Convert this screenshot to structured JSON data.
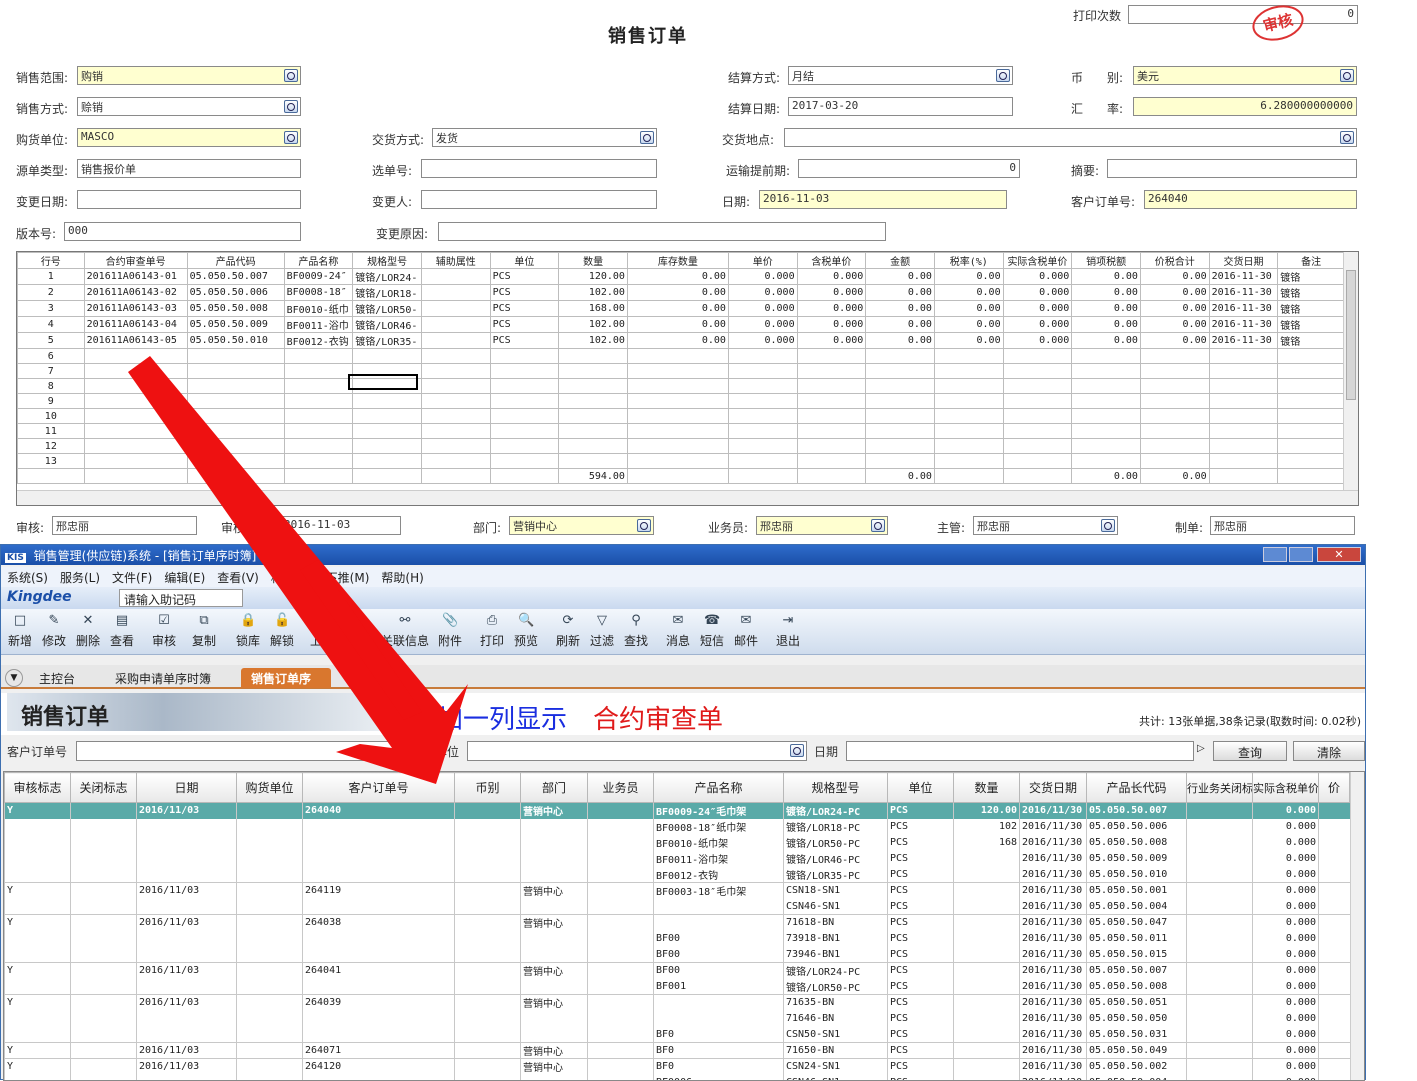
{
  "form": {
    "title": "销售订单",
    "print_count_label": "打印次数",
    "print_count": "0",
    "stamp": "审核",
    "sale_scope_label": "销售范围:",
    "sale_scope": "购销",
    "sale_method_label": "销售方式:",
    "sale_method": "赊销",
    "buyer_label": "购货单位:",
    "buyer": "MASCO",
    "source_type_label": "源单类型:",
    "source_type": "销售报价单",
    "change_date_label": "变更日期:",
    "change_date": "",
    "version_label": "版本号:",
    "version": "000",
    "delivery_method_label": "交货方式:",
    "delivery_method": "发货",
    "select_no_label": "选单号:",
    "select_no": "",
    "changer_label": "变更人:",
    "changer": "",
    "change_reason_label": "变更原因:",
    "change_reason": "",
    "settle_method_label": "结算方式:",
    "settle_method": "月结",
    "settle_date_label": "结算日期:",
    "settle_date": "2017-03-20",
    "delivery_place_label": "交货地点:",
    "delivery_place": "",
    "transport_lead_label": "运输提前期:",
    "transport_lead": "0",
    "date_label": "日期:",
    "date": "2016-11-03",
    "currency_label": "币　　别:",
    "currency": "美元",
    "rate_label": "汇　　率:",
    "rate": "6.280000000000",
    "summary_label": "摘要:",
    "summary": "",
    "cust_order_label": "客户订单号:",
    "cust_order": "264040",
    "auditor_label": "审核:",
    "auditor": "邢忠丽",
    "audit_date_label": "审核日期:",
    "audit_date": "2016-11-03",
    "dept_label": "部门:",
    "dept": "营销中心",
    "salesman_label": "业务员:",
    "salesman": "邢忠丽",
    "manager_label": "主管:",
    "manager": "邢忠丽",
    "maker_label": "制单:",
    "maker": "邢忠丽"
  },
  "grid1": {
    "headers": [
      "行号",
      "合约审查单号",
      "产品代码",
      "产品名称",
      "规格型号",
      "辅助属性",
      "单位",
      "数量",
      "库存数量",
      "单价",
      "含税单价",
      "金额",
      "税率(%)",
      "实际含税单价",
      "销项税额",
      "价税合计",
      "交货日期",
      "备注"
    ],
    "rows": [
      [
        "1",
        "201611A06143-01",
        "05.050.50.007",
        "BF0009-24″",
        "镀铬/LOR24-",
        "",
        "PCS",
        "120.00",
        "0.00",
        "0.000",
        "0.000",
        "0.00",
        "0.00",
        "0.000",
        "0.00",
        "0.00",
        "2016-11-30",
        "镀铬"
      ],
      [
        "2",
        "201611A06143-02",
        "05.050.50.006",
        "BF0008-18″",
        "镀铬/LOR18-",
        "",
        "PCS",
        "102.00",
        "0.00",
        "0.000",
        "0.000",
        "0.00",
        "0.00",
        "0.000",
        "0.00",
        "0.00",
        "2016-11-30",
        "镀铬"
      ],
      [
        "3",
        "201611A06143-03",
        "05.050.50.008",
        "BF0010-纸巾",
        "镀铬/LOR50-",
        "",
        "PCS",
        "168.00",
        "0.00",
        "0.000",
        "0.000",
        "0.00",
        "0.00",
        "0.000",
        "0.00",
        "0.00",
        "2016-11-30",
        "镀铬"
      ],
      [
        "4",
        "201611A06143-04",
        "05.050.50.009",
        "BF0011-浴巾",
        "镀铬/LOR46-",
        "",
        "PCS",
        "102.00",
        "0.00",
        "0.000",
        "0.000",
        "0.00",
        "0.00",
        "0.000",
        "0.00",
        "0.00",
        "2016-11-30",
        "镀铬"
      ],
      [
        "5",
        "201611A06143-05",
        "05.050.50.010",
        "BF0012-衣钩",
        "镀铬/LOR35-",
        "",
        "PCS",
        "102.00",
        "0.00",
        "0.000",
        "0.000",
        "0.00",
        "0.00",
        "0.000",
        "0.00",
        "0.00",
        "2016-11-30",
        "镀铬"
      ],
      [
        "6"
      ],
      [
        "7"
      ],
      [
        "8"
      ],
      [
        "9"
      ],
      [
        "10"
      ],
      [
        "11"
      ],
      [
        "12"
      ],
      [
        "13"
      ]
    ],
    "totals": {
      "qty": "594.00",
      "amount": "0.00",
      "tax": "0.00",
      "total": "0.00"
    }
  },
  "window": {
    "app_icon": "KIS",
    "title": "销售管理(供应链)系统 - [销售订单序时簿]",
    "menus": [
      "系统(S)",
      "服务(L)",
      "文件(F)",
      "编辑(E)",
      "查看(V)",
      "格式(O)",
      "下推(M)",
      "帮助(H)"
    ],
    "brand": "Kingdee",
    "helper_placeholder": "请输入助记码",
    "toolbar": [
      "新增",
      "修改",
      "删除",
      "查看",
      "审核",
      "复制",
      "锁库",
      "解锁",
      "上查",
      "下查",
      "关联信息",
      "附件",
      "打印",
      "预览",
      "刷新",
      "过滤",
      "查找",
      "消息",
      "短信",
      "邮件",
      "退出"
    ],
    "tabs": [
      "主控台",
      "采购申请单序时簿",
      "销售订单序时簿"
    ],
    "banner_title": "销售订单",
    "annotation_blue": "增加一列显示",
    "annotation_red": "合约审查单",
    "summary": "共计: 13张单据,38条记录(取数时间: 0.02秒)",
    "filter": {
      "cust_order_label": "客户订单号",
      "buyer_label": "购货单位",
      "date_label": "日期",
      "query": "查询",
      "clear": "清除"
    }
  },
  "grid2": {
    "headers": [
      "审核标志",
      "关闭标志",
      "日期",
      "购货单位",
      "客户订单号",
      "币别",
      "部门",
      "业务员",
      "产品名称",
      "规格型号",
      "单位",
      "数量",
      "交货日期",
      "产品长代码",
      "行业务关闭标志",
      "实际含税单价",
      "价"
    ],
    "rows": [
      {
        "sel": true,
        "grp": true,
        "c": [
          "Y",
          "",
          "2016/11/03",
          "",
          "264040",
          "",
          "营销中心",
          "",
          "BF0009-24″毛巾架",
          "镀铬/LOR24-PC",
          "PCS",
          "120.00",
          "2016/11/30",
          "05.050.50.007",
          "",
          "0.000"
        ]
      },
      {
        "c": [
          "",
          "",
          "",
          "",
          "",
          "",
          "",
          "",
          "BF0008-18″纸巾架",
          "镀铬/LOR18-PC",
          "PCS",
          "102",
          "2016/11/30",
          "05.050.50.006",
          "",
          "0.000"
        ]
      },
      {
        "c": [
          "",
          "",
          "",
          "",
          "",
          "",
          "",
          "",
          "BF0010-纸巾架",
          "镀铬/LOR50-PC",
          "PCS",
          "168",
          "2016/11/30",
          "05.050.50.008",
          "",
          "0.000"
        ]
      },
      {
        "c": [
          "",
          "",
          "",
          "",
          "",
          "",
          "",
          "",
          "BF0011-浴巾架",
          "镀铬/LOR46-PC",
          "PCS",
          "",
          "2016/11/30",
          "05.050.50.009",
          "",
          "0.000"
        ]
      },
      {
        "c": [
          "",
          "",
          "",
          "",
          "",
          "",
          "",
          "",
          "BF0012-衣钩",
          "镀铬/LOR35-PC",
          "PCS",
          "",
          "2016/11/30",
          "05.050.50.010",
          "",
          "0.000"
        ]
      },
      {
        "grp": true,
        "c": [
          "Y",
          "",
          "2016/11/03",
          "",
          "264119",
          "",
          "营销中心",
          "",
          "BF0003-18″毛巾架",
          "CSN18-SN1",
          "PCS",
          "",
          "2016/11/30",
          "05.050.50.001",
          "",
          "0.000"
        ]
      },
      {
        "c": [
          "",
          "",
          "",
          "",
          "",
          "",
          "",
          "",
          "",
          "CSN46-SN1",
          "PCS",
          "",
          "2016/11/30",
          "05.050.50.004",
          "",
          "0.000"
        ]
      },
      {
        "grp": true,
        "c": [
          "Y",
          "",
          "2016/11/03",
          "",
          "264038",
          "",
          "营销中心",
          "",
          "",
          "71618-BN",
          "PCS",
          "",
          "2016/11/30",
          "05.050.50.047",
          "",
          "0.000"
        ]
      },
      {
        "c": [
          "",
          "",
          "",
          "",
          "",
          "",
          "",
          "",
          "BF00",
          "73918-BN1",
          "PCS",
          "",
          "2016/11/30",
          "05.050.50.011",
          "",
          "0.000"
        ]
      },
      {
        "c": [
          "",
          "",
          "",
          "",
          "",
          "",
          "",
          "",
          "BF00",
          "73946-BN1",
          "PCS",
          "",
          "2016/11/30",
          "05.050.50.015",
          "",
          "0.000"
        ]
      },
      {
        "grp": true,
        "c": [
          "Y",
          "",
          "2016/11/03",
          "",
          "264041",
          "",
          "营销中心",
          "",
          "BF00",
          "镀铬/LOR24-PC",
          "PCS",
          "",
          "2016/11/30",
          "05.050.50.007",
          "",
          "0.000"
        ]
      },
      {
        "c": [
          "",
          "",
          "",
          "",
          "",
          "",
          "",
          "",
          "BF001",
          "镀铬/LOR50-PC",
          "PCS",
          "",
          "2016/11/30",
          "05.050.50.008",
          "",
          "0.000"
        ]
      },
      {
        "grp": true,
        "c": [
          "Y",
          "",
          "2016/11/03",
          "",
          "264039",
          "",
          "营销中心",
          "",
          "",
          "71635-BN",
          "PCS",
          "",
          "2016/11/30",
          "05.050.50.051",
          "",
          "0.000"
        ]
      },
      {
        "c": [
          "",
          "",
          "",
          "",
          "",
          "",
          "",
          "",
          "",
          "71646-BN",
          "PCS",
          "",
          "2016/11/30",
          "05.050.50.050",
          "",
          "0.000"
        ]
      },
      {
        "c": [
          "",
          "",
          "",
          "",
          "",
          "",
          "",
          "",
          "BF0",
          "CSN50-SN1",
          "PCS",
          "",
          "2016/11/30",
          "05.050.50.031",
          "",
          "0.000"
        ]
      },
      {
        "grp": true,
        "c": [
          "Y",
          "",
          "2016/11/03",
          "",
          "264071",
          "",
          "营销中心",
          "",
          "BF0",
          "71650-BN",
          "PCS",
          "",
          "2016/11/30",
          "05.050.50.049",
          "",
          "0.000"
        ]
      },
      {
        "grp": true,
        "c": [
          "Y",
          "",
          "2016/11/03",
          "",
          "264120",
          "",
          "营销中心",
          "",
          "BF0",
          "CSN24-SN1",
          "PCS",
          "",
          "2016/11/30",
          "05.050.50.002",
          "",
          "0.000"
        ]
      },
      {
        "c": [
          "",
          "",
          "",
          "",
          "",
          "",
          "",
          "",
          "BF0006",
          "CSN46-SN1",
          "PCS",
          "",
          "2016/11/30",
          "05.050.50.004",
          "",
          "0.000"
        ]
      }
    ]
  }
}
